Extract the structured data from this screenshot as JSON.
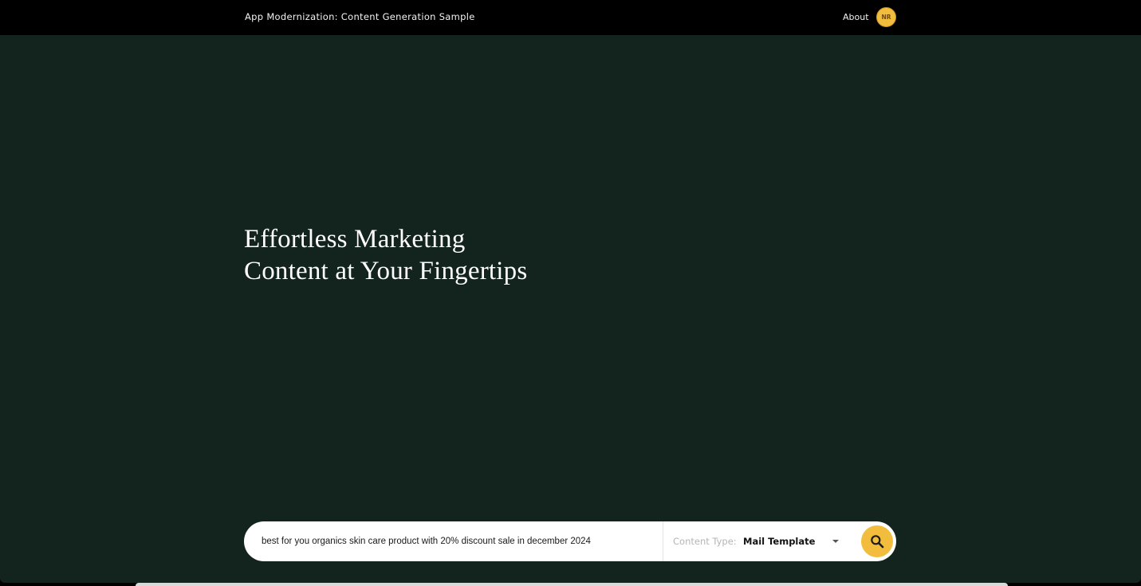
{
  "header": {
    "app_title": "App Modernization: Content Generation Sample",
    "about_label": "About",
    "avatar_initials": "NR"
  },
  "hero": {
    "headline_line1": "Effortless Marketing",
    "headline_line2": "Content at Your Fingertips"
  },
  "search": {
    "prompt_value": "best for you organics skin care product with 20% discount sale in december 2024",
    "content_type_label": "Content Type:",
    "content_type_value": "Mail Template",
    "search_icon": "search-icon"
  },
  "colors": {
    "background": "#13231e",
    "topbar": "#000000",
    "accent": "#f2bd3c"
  }
}
